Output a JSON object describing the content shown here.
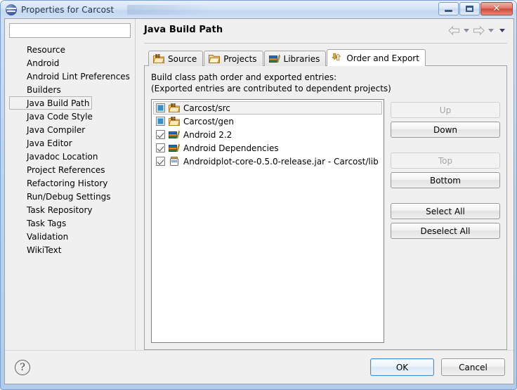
{
  "window": {
    "title": "Properties for Carcost",
    "app_icon": "eclipse-globe-icon",
    "minimize_label": "Minimize",
    "maximize_label": "Maximize",
    "close_label": "Close",
    "close_glyph": "✕"
  },
  "sidebar": {
    "filter_value": "",
    "filter_placeholder": "",
    "items": [
      {
        "label": "Resource",
        "selected": false
      },
      {
        "label": "Android",
        "selected": false
      },
      {
        "label": "Android Lint Preferences",
        "selected": false
      },
      {
        "label": "Builders",
        "selected": false
      },
      {
        "label": "Java Build Path",
        "selected": true
      },
      {
        "label": "Java Code Style",
        "selected": false
      },
      {
        "label": "Java Compiler",
        "selected": false
      },
      {
        "label": "Java Editor",
        "selected": false
      },
      {
        "label": "Javadoc Location",
        "selected": false
      },
      {
        "label": "Project References",
        "selected": false
      },
      {
        "label": "Refactoring History",
        "selected": false
      },
      {
        "label": "Run/Debug Settings",
        "selected": false
      },
      {
        "label": "Task Repository",
        "selected": false
      },
      {
        "label": "Task Tags",
        "selected": false
      },
      {
        "label": "Validation",
        "selected": false
      },
      {
        "label": "WikiText",
        "selected": false
      }
    ]
  },
  "page": {
    "title": "Java Build Path",
    "nav": {
      "back_icon": "back-arrow-icon",
      "back_menu_icon": "chevron-down-icon",
      "forward_icon": "forward-arrow-icon",
      "forward_menu_icon": "chevron-down-icon",
      "view_menu_icon": "view-menu-icon"
    }
  },
  "tabs": [
    {
      "label": "Source",
      "icon": "source-folder-icon",
      "active": false
    },
    {
      "label": "Projects",
      "icon": "open-folder-icon",
      "active": false
    },
    {
      "label": "Libraries",
      "icon": "libraries-books-icon",
      "active": false
    },
    {
      "label": "Order and Export",
      "icon": "order-export-arrows-icon",
      "active": true
    }
  ],
  "order_export": {
    "description_line1": "Build class path order and exported entries:",
    "description_line2": "(Exported entries are contributed to dependent projects)",
    "entries": [
      {
        "label": "Carcost/src",
        "icon": "source-folder-icon",
        "check_state": "grayed",
        "selected": true
      },
      {
        "label": "Carcost/gen",
        "icon": "source-folder-icon",
        "check_state": "grayed",
        "selected": false
      },
      {
        "label": "Android 2.2",
        "icon": "libraries-books-icon",
        "check_state": "checked",
        "selected": false
      },
      {
        "label": "Android Dependencies",
        "icon": "libraries-books-icon",
        "check_state": "checked",
        "selected": false
      },
      {
        "label": "Androidplot-core-0.5.0-release.jar - Carcost/lib",
        "icon": "jar-icon",
        "check_state": "checked",
        "selected": false
      }
    ],
    "buttons": [
      {
        "label": "Up",
        "enabled": false,
        "group_end": false
      },
      {
        "label": "Down",
        "enabled": true,
        "group_end": true
      },
      {
        "label": "Top",
        "enabled": false,
        "group_end": false
      },
      {
        "label": "Bottom",
        "enabled": true,
        "group_end": true
      },
      {
        "label": "Select All",
        "enabled": true,
        "group_end": false
      },
      {
        "label": "Deselect All",
        "enabled": true,
        "group_end": false
      }
    ]
  },
  "footer": {
    "help_icon": "help-question-icon",
    "help_glyph": "?",
    "ok_label": "OK",
    "cancel_label": "Cancel"
  },
  "colors": {
    "titlebar_blue": "#cfe0f4",
    "close_red": "#cc4b39",
    "default_button_border": "#3c8fd0",
    "checkbox_fill": "#3b8ec4",
    "folder_orange": "#e8a33d"
  }
}
